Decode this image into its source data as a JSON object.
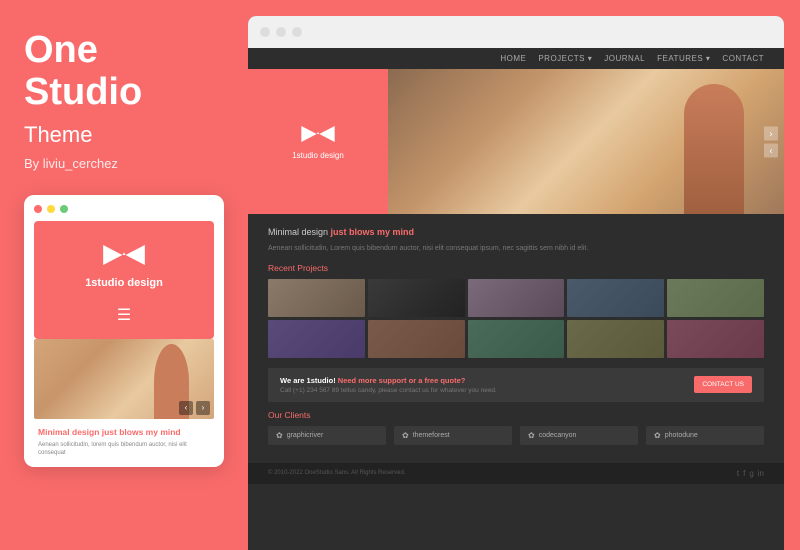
{
  "left": {
    "title_line1": "One",
    "title_line2": "Studio",
    "subtitle": "Theme",
    "author": "By liviu_cerchez",
    "mobile": {
      "brand": "1studio design",
      "heading": "Minimal design just blows my mind",
      "body_text": "Aenean sollicitudin, lorem quis bibendum auctor, nisi elit consequat"
    }
  },
  "right": {
    "nav_items": [
      "HOME",
      "PROJECTS ▾",
      "JOURNAL",
      "FEATURES ▾",
      "CONTACT"
    ],
    "hero_brand": "1studio design",
    "tagline_normal": "Minimal design ",
    "tagline_accent": "just blows my mind",
    "description": "Aenean sollicitudin, Lorem quis bibendum auctor, nisi elit consequat ipsum, nec sagittis sem nibh id elit.",
    "recent_projects": "Recent Projects",
    "cta_heading_pre": "We are 1studio! ",
    "cta_heading_accent": "Need more support or a free quote?",
    "cta_phone": "Call (+1) 234 567 89 tellus candy, please contact us for whatever you need.",
    "cta_button": "CONTACT US",
    "clients_title": "Our Clients",
    "clients": [
      {
        "icon": "✿",
        "name": "graphicriver"
      },
      {
        "icon": "✿",
        "name": "themeforest"
      },
      {
        "icon": "✿",
        "name": "codecanyon"
      },
      {
        "icon": "✿",
        "name": "photodune"
      }
    ],
    "footer_copy": "© 2010-2022 OneStudio Sans. All Rights Reserved.",
    "social_icons": [
      "t",
      "f",
      "g",
      "in"
    ]
  },
  "colors": {
    "accent": "#f96b6b",
    "dark_bg": "#2d2d2d",
    "white": "#ffffff"
  }
}
